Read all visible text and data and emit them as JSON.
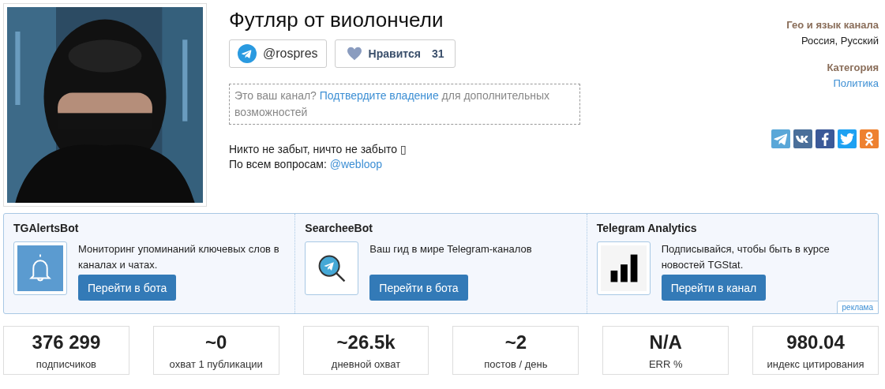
{
  "channel": {
    "title": "Футляр от виолончели",
    "username": "@rospres",
    "like": {
      "label": "Нравится",
      "count": "31"
    },
    "claim": {
      "before": "Это ваш канал?",
      "link": "Подтвердите владение",
      "after": "для дополнительных возможностей"
    },
    "description": [
      {
        "text": "Никто не забыт, ничто не забыто ▯"
      },
      {
        "text": "По всем вопросам:",
        "link": "@webloop"
      }
    ]
  },
  "info": [
    {
      "label": "Гео и язык канала",
      "value": "Россия, Русский",
      "kind": "text"
    },
    {
      "label": "Категория",
      "value": "Политика",
      "kind": "link"
    }
  ],
  "share": [
    {
      "kind": "telegram",
      "color": "#5aa7d8"
    },
    {
      "kind": "vk",
      "color": "#4a6f9a"
    },
    {
      "kind": "facebook",
      "color": "#3b5998"
    },
    {
      "kind": "twitter",
      "color": "#1da1f2"
    },
    {
      "kind": "ok",
      "color": "#ee8130"
    }
  ],
  "ads": {
    "items": [
      {
        "title": "TGAlertsBot",
        "kind": "bell",
        "text": "Мониторинг упоминаний ключевых слов в каналах и чатах.",
        "button": "Перейти в бота"
      },
      {
        "title": "SearcheeBot",
        "kind": "search",
        "text": "Ваш гид в мире Telegram-каналов",
        "button": "Перейти в бота"
      },
      {
        "title": "Telegram Analytics",
        "kind": "bars",
        "text": "Подписывайся, чтобы быть в курсе новостей TGStat.",
        "button": "Перейти в канал"
      }
    ],
    "badge": "реклама"
  },
  "stats": [
    {
      "value": "376 299",
      "label": "подписчиков"
    },
    {
      "value": "~0",
      "label": "охват 1 публикации"
    },
    {
      "value": "~26.5k",
      "label": "дневной охват"
    },
    {
      "value": "~2",
      "label": "постов / день"
    },
    {
      "value": "N/A",
      "label": "ERR %"
    },
    {
      "value": "980.04",
      "label": "индекс цитирования"
    }
  ]
}
